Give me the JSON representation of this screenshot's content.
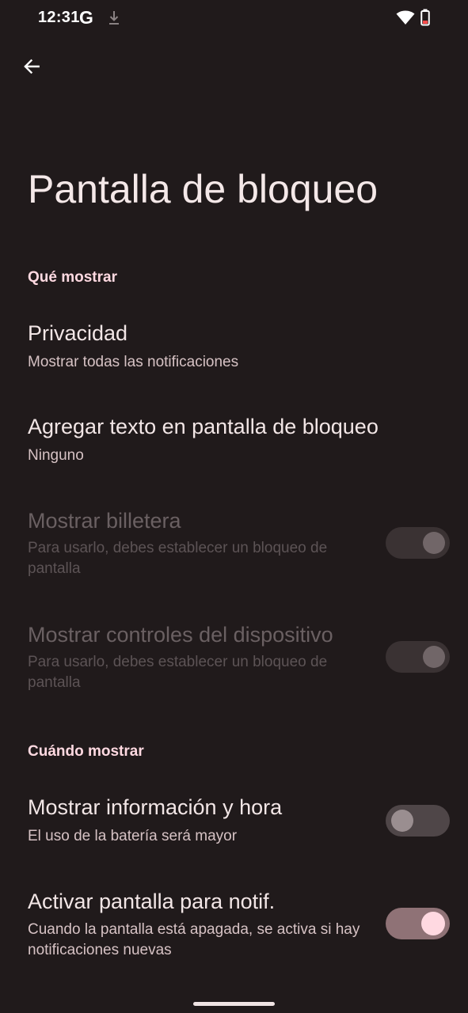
{
  "status_bar": {
    "time": "12:31",
    "g_letter": "G",
    "icons": [
      "google-icon",
      "download-icon",
      "wifi-icon",
      "battery-icon"
    ]
  },
  "app_bar": {
    "back_icon": "arrow-back-icon"
  },
  "page": {
    "title": "Pantalla de bloqueo"
  },
  "sections": [
    {
      "header": "Qué mostrar",
      "items": [
        {
          "title": "Privacidad",
          "summary": "Mostrar todas las notificaciones",
          "enabled": true
        },
        {
          "title": "Agregar texto en pantalla de bloqueo",
          "summary": "Ninguno",
          "enabled": true
        },
        {
          "title": "Mostrar billetera",
          "summary": "Para usarlo, debes establecer un bloqueo de pantalla",
          "enabled": false,
          "switch": "on"
        },
        {
          "title": "Mostrar controles del dispositivo",
          "summary": "Para usarlo, debes establecer un bloqueo de pantalla",
          "enabled": false,
          "switch": "on"
        }
      ]
    },
    {
      "header": "Cuándo mostrar",
      "items": [
        {
          "title": "Mostrar información y hora",
          "summary": "El uso de la batería será mayor",
          "enabled": true,
          "switch": "off"
        },
        {
          "title": "Activar pantalla para notif.",
          "summary": "Cuando la pantalla está apagada, se activa si hay notificaciones nuevas",
          "enabled": true,
          "switch": "on"
        }
      ]
    }
  ],
  "colors": {
    "background": "#201a1b",
    "section_header": "#ffd9e1",
    "switch_on_track": "#8f7276",
    "switch_on_thumb": "#ffd9e1"
  }
}
